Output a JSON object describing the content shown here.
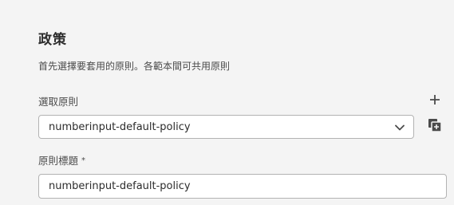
{
  "policy": {
    "heading": "政策",
    "description": "首先選擇要套用的原則。各範本間可共用原則",
    "select_policy_label": "選取原則",
    "selected_policy": "numberinput-default-policy",
    "policy_title_label": "原則標題",
    "required_marker": "*",
    "policy_title_value": "numberinput-default-policy"
  },
  "icons": {
    "add": "add-icon",
    "copy": "copy-icon",
    "dropdown": "chevron-down-icon"
  }
}
